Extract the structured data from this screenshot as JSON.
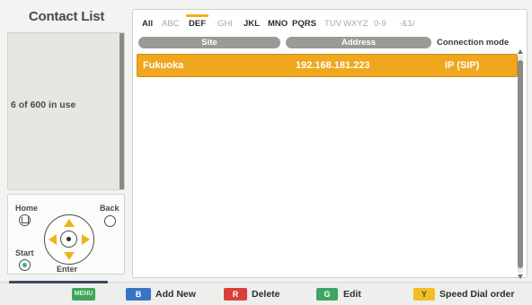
{
  "title": "Contact List",
  "usage": "6 of 600 in use",
  "remote": {
    "home": "Home",
    "back": "Back",
    "start": "Start",
    "enter": "Enter"
  },
  "tabs": [
    {
      "label": "All",
      "enabled": true
    },
    {
      "label": "ABC",
      "enabled": false
    },
    {
      "label": "DEF",
      "enabled": true,
      "active": true
    },
    {
      "label": "GHI",
      "enabled": false
    },
    {
      "label": "JKL",
      "enabled": true
    },
    {
      "label": "MNO",
      "enabled": true
    },
    {
      "label": "PQRS",
      "enabled": true
    },
    {
      "label": "TUV",
      "enabled": false
    },
    {
      "label": "WXYZ",
      "enabled": false
    },
    {
      "label": "0-9",
      "enabled": false
    },
    {
      "label": "-&1/",
      "enabled": false
    }
  ],
  "columns": [
    "Site",
    "Address",
    "Connection mode"
  ],
  "rows": [
    {
      "site": "Fukuoka",
      "address": "192.168.181.223",
      "mode": "IP (SIP)"
    }
  ],
  "footer": {
    "menu_key": "MENU",
    "b_key": "B",
    "b_label": "Add New",
    "r_key": "R",
    "r_label": "Delete",
    "g_key": "G",
    "g_label": "Edit",
    "y_key": "Y",
    "y_label": "Speed Dial order"
  },
  "colors": {
    "accent": "#f0a71f",
    "header_grey": "#9a9a96",
    "blue_key": "#3873c4",
    "red_key": "#d9403a",
    "green_key": "#3da563",
    "yellow_key": "#f0c022"
  }
}
